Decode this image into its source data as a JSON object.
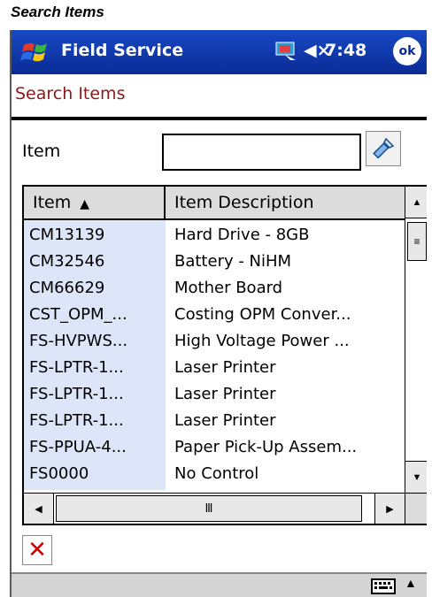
{
  "caption": "Search Items",
  "titlebar": {
    "app_title": "Field Service",
    "clock": "7:48",
    "ok_label": "ok",
    "speaker": "◀×"
  },
  "form": {
    "title": "Search Items",
    "item_label": "Item",
    "item_value": ""
  },
  "grid": {
    "columns": [
      "Item",
      "Item Description"
    ],
    "sort_indicator": "▲",
    "rows": [
      {
        "id": "CM13139",
        "desc": "Hard Drive - 8GB"
      },
      {
        "id": "CM32546",
        "desc": "Battery - NiHM"
      },
      {
        "id": "CM66629",
        "desc": "Mother Board"
      },
      {
        "id": "CST_OPM_...",
        "desc": "Costing OPM Conver..."
      },
      {
        "id": "FS-HVPWS...",
        "desc": "High Voltage Power ..."
      },
      {
        "id": "FS-LPTR-1...",
        "desc": "Laser Printer"
      },
      {
        "id": "FS-LPTR-1...",
        "desc": "Laser Printer"
      },
      {
        "id": "FS-LPTR-1...",
        "desc": "Laser Printer"
      },
      {
        "id": "FS-PPUA-4...",
        "desc": "Paper Pick-Up Assem..."
      },
      {
        "id": "FS0000",
        "desc": "No Control"
      }
    ]
  },
  "colors": {
    "titlebar": "#0a2c96",
    "form_title": "#8a1a1a",
    "id_column_bg": "#dde6f8",
    "delete": "#d00000"
  },
  "icons": {
    "start": "windows-flag-icon",
    "connectivity": "connectivity-icon",
    "search": "flashlight-search-icon",
    "delete": "red-x-icon",
    "keyboard": "keyboard-icon"
  }
}
